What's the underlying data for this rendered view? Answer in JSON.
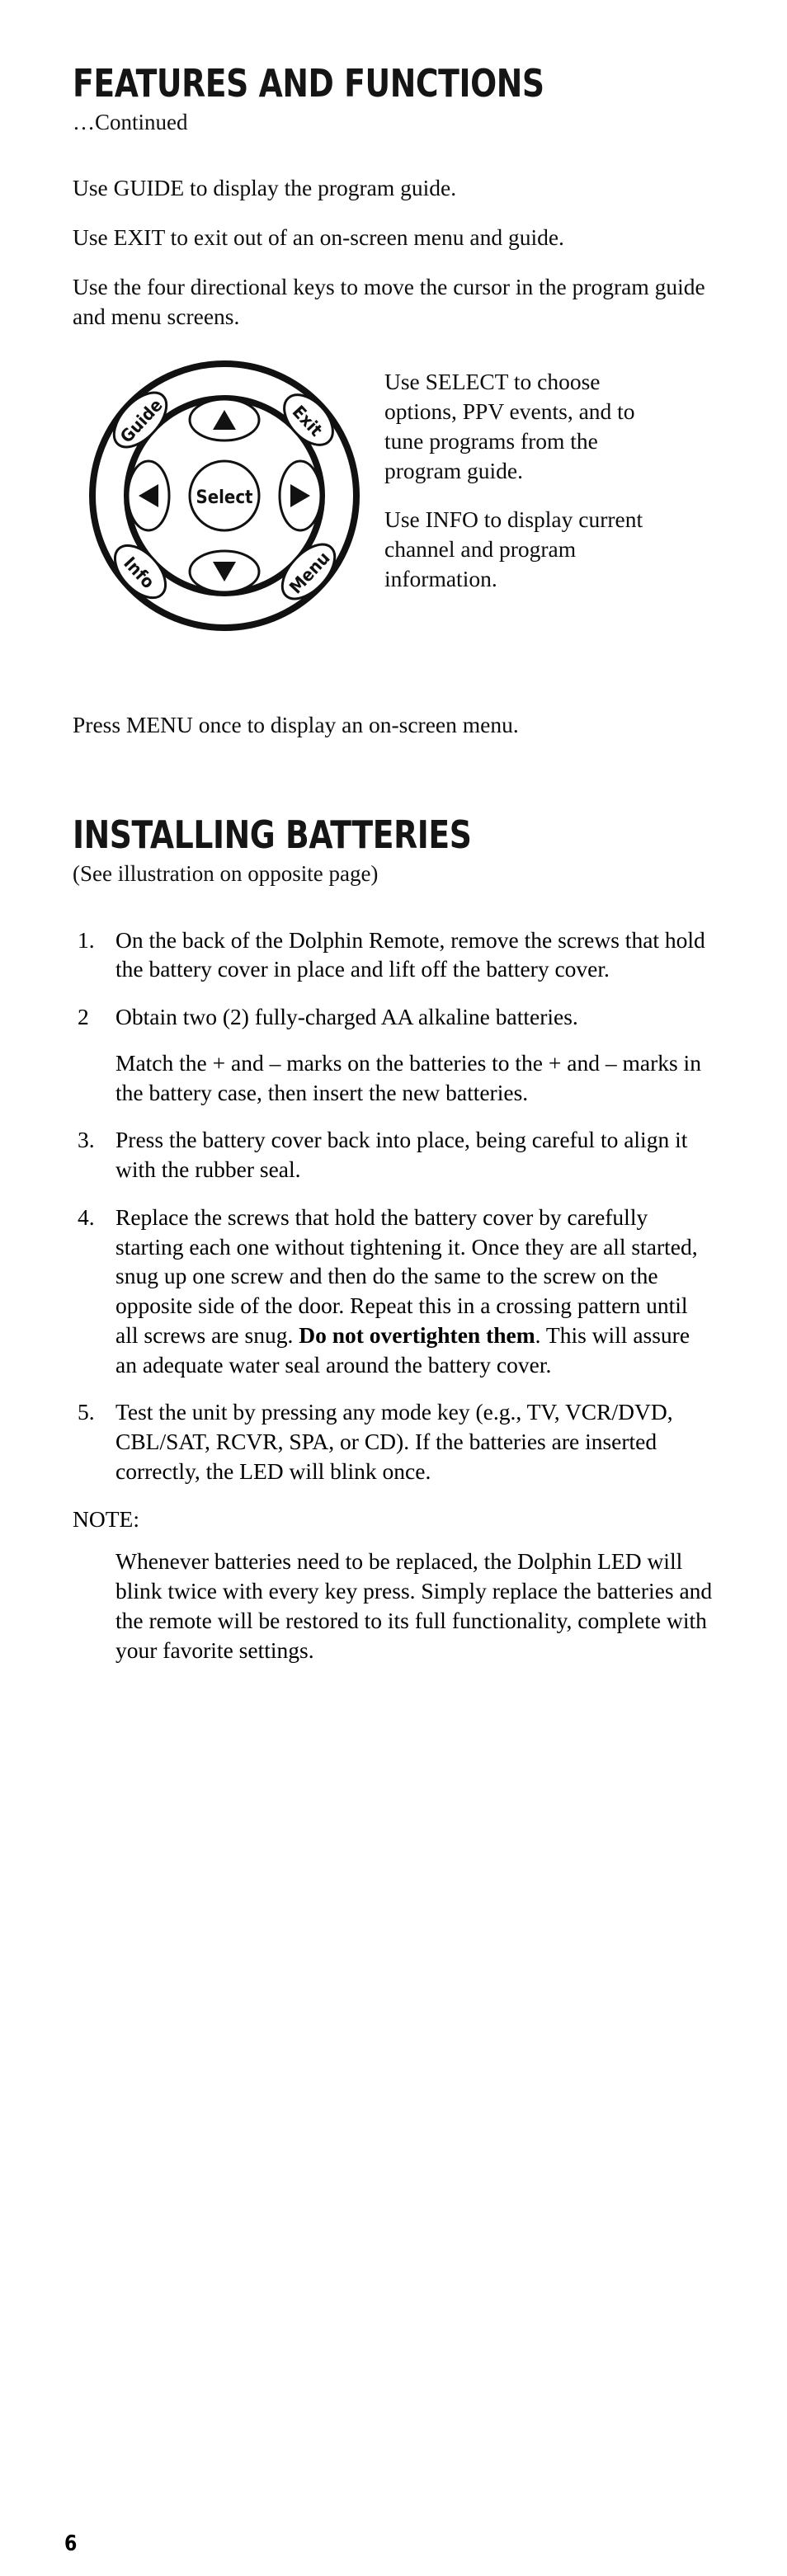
{
  "page": {
    "number": "6"
  },
  "section_features": {
    "title": "FEATURES AND FUNCTIONS",
    "subtitle": "…Continued",
    "paragraphs": [
      "Use GUIDE to display the program guide.",
      "Use EXIT to exit out of an on-screen menu and guide.",
      "Use the four directional keys to move the cursor in the program guide and menu screens."
    ],
    "side_paragraphs": [
      "Use SELECT to choose options, PPV events, and to tune programs from the program guide.",
      "Use INFO to display current channel and program information."
    ],
    "closing_paragraph": "Press MENU once to display an on-screen menu."
  },
  "diagram": {
    "name": "remote-navigation-keypad",
    "center_button": "Select",
    "corner_buttons": [
      {
        "label": "Guide",
        "position": "top-left"
      },
      {
        "label": "Exit",
        "position": "top-right"
      },
      {
        "label": "Info",
        "position": "bottom-left"
      },
      {
        "label": "Menu",
        "position": "bottom-right"
      }
    ],
    "direction_buttons": [
      {
        "label": "up-arrow",
        "glyph": "▲"
      },
      {
        "label": "left-arrow",
        "glyph": "◀"
      },
      {
        "label": "right-arrow",
        "glyph": "▶"
      },
      {
        "label": "down-arrow",
        "glyph": "▼"
      }
    ]
  },
  "section_batteries": {
    "title": "INSTALLING BATTERIES",
    "subtitle": "(See illustration on opposite page)",
    "steps": [
      {
        "number": "1.",
        "text": "On the back of the Dolphin Remote, remove the screws that hold the battery cover in place and lift off the battery cover."
      },
      {
        "number": "2",
        "text": "Obtain two (2) fully-charged AA alkaline batteries.",
        "sub_text": "Match the + and – marks on the batteries to the + and – marks in the battery case, then insert the new batteries."
      },
      {
        "number": "3.",
        "text": "Press the battery cover back into place, being careful to align it with the rubber seal."
      },
      {
        "number": "4.",
        "text_before_bold": "Replace the screws that hold the battery cover by carefully starting each one without tightening it. Once they are all started, snug up one screw and then do the same to the screw on the opposite side of the door. Repeat this in a crossing pattern until all screws are snug. ",
        "bold_text": "Do not overtighten them",
        "text_after_bold": ". This will assure an adequate water seal around the battery cover."
      },
      {
        "number": "5.",
        "text": "Test the unit by pressing any mode key (e.g., TV, VCR/DVD, CBL/SAT, RCVR, SPA, or CD). If the batteries are inserted correctly, the LED will blink once."
      }
    ],
    "note_label": "NOTE:",
    "note_text": "Whenever batteries need to be replaced, the Dolphin LED will blink twice with every key press. Simply replace the batteries and the remote will be restored to its full functionality, complete with your favorite settings."
  }
}
